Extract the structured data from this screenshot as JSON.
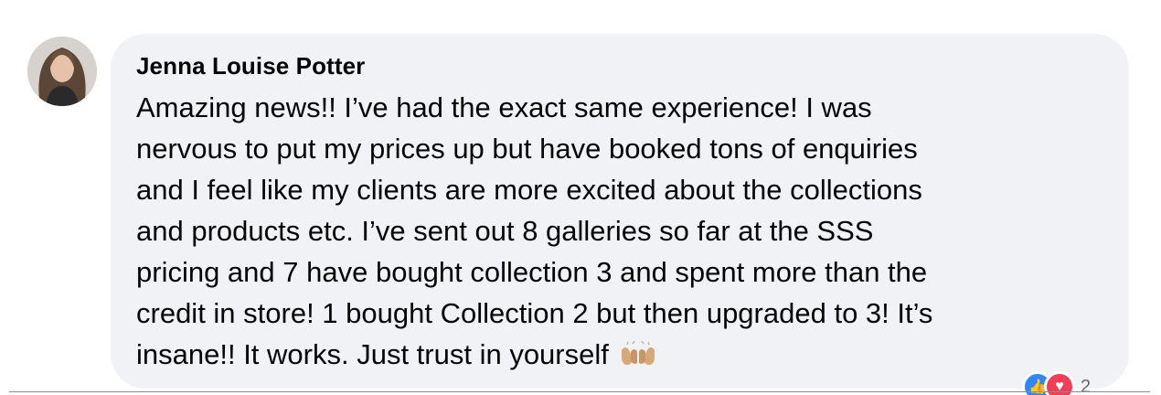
{
  "comment": {
    "author": "Jenna Louise Potter",
    "lines": [
      "Amazing news!! I’ve had the exact same experience! I was",
      "nervous to put my prices up but have booked tons of enquiries",
      "and I feel like my clients are more excited about the collections",
      "and products etc. I’ve sent out 8 galleries so far at the SSS",
      "pricing and 7 have bought collection 3 and spent more than the",
      "credit in store! 1 bought Collection 2 but then upgraded to 3! It’s",
      "insane!! It works. Just trust in yourself"
    ],
    "emoji": "raising-hands-emoji",
    "reactions": {
      "icons": [
        "like-icon",
        "love-icon"
      ],
      "count": "2"
    }
  },
  "colors": {
    "bubble": "#f0f2f5",
    "text": "#050505",
    "like": "#2d88ff",
    "love": "#f33e58"
  }
}
